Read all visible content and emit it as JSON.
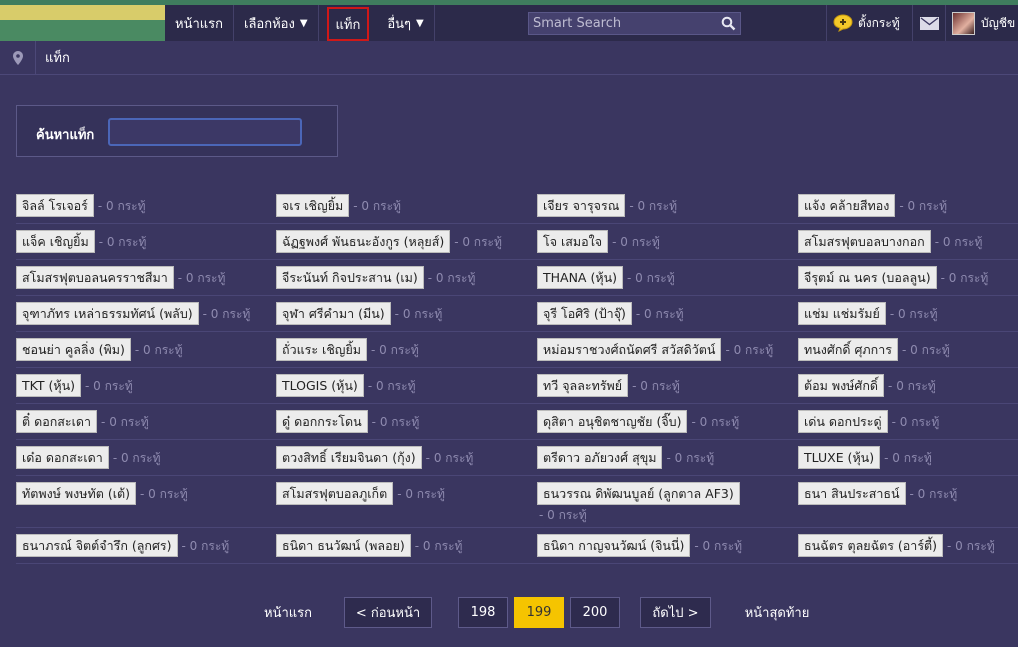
{
  "nav": {
    "home": "หน้าแรก",
    "rooms": "เลือกห้อง",
    "tags": "แท็ก",
    "others": "อื่นๆ",
    "search_placeholder": "Smart Search",
    "post": "ตั้งกระทู้",
    "account": "บัญชีข"
  },
  "breadcrumb": {
    "label": "แท็ก"
  },
  "tag_search": {
    "label": "ค้นหาแท็ก",
    "value": ""
  },
  "tags": [
    [
      {
        "name": "จิลล์ โรเจอร์",
        "count": "- 0 กระทู้"
      },
      {
        "name": "จเร เชิญยิ้ม",
        "count": "- 0 กระทู้"
      },
      {
        "name": "เจียร จารุจรณ",
        "count": "- 0 กระทู้"
      },
      {
        "name": "แจ้ง คล้ายสีทอง",
        "count": "- 0 กระทู้"
      }
    ],
    [
      {
        "name": "แจ็ค เชิญยิ้ม",
        "count": "- 0 กระทู้"
      },
      {
        "name": "ฉัฏฐพงศ์ พันธนะอังกูร (หลุยส์)",
        "count": "- 0 กระทู้"
      },
      {
        "name": "โจ เสมอใจ",
        "count": "- 0 กระทู้"
      },
      {
        "name": "สโมสรฟุตบอลบางกอก",
        "count": "- 0 กระทู้"
      }
    ],
    [
      {
        "name": "สโมสรฟุตบอลนครราชสีมา",
        "count": "- 0 กระทู้"
      },
      {
        "name": "จีระนันท์ กิจประสาน (เม)",
        "count": "- 0 กระทู้"
      },
      {
        "name": "THANA (หุ้น)",
        "count": "- 0 กระทู้"
      },
      {
        "name": "จีรุตม์ ณ นคร (บอลลูน)",
        "count": "- 0 กระทู้"
      }
    ],
    [
      {
        "name": "จุฑาภัทร เหล่าธรรมทัศน์ (พลับ)",
        "count": "- 0 กระทู้"
      },
      {
        "name": "จุฬา ศรีคำมา (มีน)",
        "count": "- 0 กระทู้"
      },
      {
        "name": "จุรี โอศิริ (ป้าจุ๊)",
        "count": "- 0 กระทู้"
      },
      {
        "name": "แช่ม แช่มรัมย์",
        "count": "- 0 กระทู้"
      }
    ],
    [
      {
        "name": "ชอนย่า คูลลิ่ง (พิม)",
        "count": "- 0 กระทู้"
      },
      {
        "name": "ถั่วแระ เชิญยิ้ม",
        "count": "- 0 กระทู้"
      },
      {
        "name": "หม่อมราชวงศ์ถนัดศรี สวัสดิวัตน์",
        "count": "- 0 กระทู้"
      },
      {
        "name": "ทนงศักดิ์ ศุภการ",
        "count": "- 0 กระทู้"
      }
    ],
    [
      {
        "name": "TKT (หุ้น)",
        "count": "- 0 กระทู้"
      },
      {
        "name": "TLOGIS (หุ้น)",
        "count": "- 0 กระทู้"
      },
      {
        "name": "ทวี จุลละทรัพย์",
        "count": "- 0 กระทู้"
      },
      {
        "name": "ต้อม พงษ์ศักดิ์",
        "count": "- 0 กระทู้"
      }
    ],
    [
      {
        "name": "ติ๋ ดอกสะเดา",
        "count": "- 0 กระทู้"
      },
      {
        "name": "ดู๋ ดอกกระโดน",
        "count": "- 0 กระทู้"
      },
      {
        "name": "ดุสิตา อนุชิตชาญชัย (จิ๊บ)",
        "count": "- 0 กระทู้"
      },
      {
        "name": "เด่น ดอกประดู่",
        "count": "- 0 กระทู้"
      }
    ],
    [
      {
        "name": "เด๋อ ดอกสะเดา",
        "count": "- 0 กระทู้"
      },
      {
        "name": "ตวงสิทธิ์ เรียมจินดา (กุ้ง)",
        "count": "- 0 กระทู้"
      },
      {
        "name": "ตรีดาว อภัยวงศ์ สุขุม",
        "count": "- 0 กระทู้"
      },
      {
        "name": "TLUXE (หุ้น)",
        "count": "- 0 กระทู้"
      }
    ],
    [
      {
        "name": "ทัตพงษ์ พงษทัต (เต้)",
        "count": "- 0 กระทู้"
      },
      {
        "name": "สโมสรฟุตบอลภูเก็ต",
        "count": "- 0 กระทู้"
      },
      {
        "name": "ธนวรรณ ดิพัฒนบูลย์ (ลูกตาล AF3)",
        "count": "- 0 กระทู้"
      },
      {
        "name": "ธนา สินประสาธน์",
        "count": "- 0 กระทู้"
      }
    ],
    [
      {
        "name": "ธนาภรณ์ จิตต์จำรึก (ลูกศร)",
        "count": "- 0 กระทู้"
      },
      {
        "name": "ธนิดา ธนวัฒน์ (พลอย)",
        "count": "- 0 กระทู้"
      },
      {
        "name": "ธนิดา กาญจนวัฒน์ (จินนี่)",
        "count": "- 0 กระทู้"
      },
      {
        "name": "ธนฉัตร ตุลยฉัตร (อาร์ตี้)",
        "count": "- 0 กระทู้"
      }
    ]
  ],
  "pagination": {
    "first": "หน้าแรก",
    "prev": "< ก่อนหน้า",
    "pages": [
      "198",
      "199",
      "200"
    ],
    "current": "199",
    "next": "ถัดไป >",
    "last": "หน้าสุดท้าย"
  },
  "colors": {
    "accent": "#f5c400",
    "active_outline": "#d01818",
    "background": "#3a3660"
  }
}
